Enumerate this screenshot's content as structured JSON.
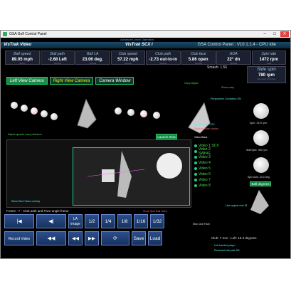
{
  "window": {
    "title": "GSA Golf Control Panel",
    "minimize": "–",
    "maximize": "□",
    "close": "✕"
  },
  "status": {
    "mode": "Advanced Level Operation",
    "version": "GSA Control Panel : V10.1.1.4 · CPU Idle"
  },
  "header": {
    "left": "VisTrak Video",
    "center": "VisTrak SCX i",
    "right": "GSA Control Panel : V10.1.1.4 - CPU Idle"
  },
  "stats": [
    {
      "label": "Ball speed",
      "value": "89.05 mph",
      "sub": "Swing"
    },
    {
      "label": "Ball path",
      "value": "-2.68 Left",
      "sub": "Vertical"
    },
    {
      "label": "Ball LA",
      "value": "23.06 deg.",
      "sub": "Vertical"
    },
    {
      "label": "Club speed",
      "value": "57.22 mph",
      "sub": "Vertical"
    },
    {
      "label": "Club path",
      "value": "-2.73 out-to-in",
      "sub": "Vertical"
    },
    {
      "label": "Club face",
      "value": "5.86 open",
      "sub": "Vertical"
    },
    {
      "label": "AOA",
      "value": "22° dn",
      "sub": "Vertical"
    },
    {
      "label": "Spin rate",
      "value": "1472 rpm",
      "sub": "Total"
    }
  ],
  "smash": {
    "label": "Smash:",
    "value": "1.56"
  },
  "side_spin": {
    "label": "Side spin",
    "value": "780 rpm",
    "sub": "Spin Axis: 33.0 deg"
  },
  "cameras": {
    "left": "Left View Camera",
    "right": "Right View Camera",
    "window": "Camera Window"
  },
  "labels": {
    "carry_adjust": "Carry Adjust",
    "show_carry": "Show carry",
    "perspective": "Perspective Correction ON",
    "adjust_speeds": "Adjust speeds / carry distance",
    "launch_shot": "Launch Shot",
    "hit_video": "Hit video hits: 512",
    "sample_video": "Sample Video loaded",
    "spin_rpm": "Spin: 1472 rpm",
    "sidespin": "SideSpin: 780 rpm",
    "spin_axis": "Spin Axis: 33.0 deg",
    "ball_degrees": "Ball degrees",
    "use_orig_club": "Use orginal club IR",
    "frame_info": "Frame : 7 - Club path and Face angle frame",
    "show_spin": "Show Spin Ball video",
    "max_club_face": "Max Club Face",
    "club_info": "Club: 7 Iron - Loft: 16.3 degrees",
    "left_hand": "Left handed player",
    "reversed": "Reversed ball path R/L",
    "show_overlay": "Show Shot Video overlay",
    "video_bank": "Video Bank :"
  },
  "video_bank": [
    "Video 1 SCX",
    "Video 2 SWING",
    "Video 3",
    "Video 4",
    "Video 5",
    "Video 6",
    "Video 7",
    "Video 8"
  ],
  "transport": {
    "la_image": "LA image",
    "rate_1_2": "1/2",
    "rate_1_4": "1/4",
    "rate_1_8": "1/8",
    "rate_1_16": "1/16",
    "rate_1_32": "1/32",
    "record": "Record Video",
    "save": "Save",
    "load": "Load"
  }
}
